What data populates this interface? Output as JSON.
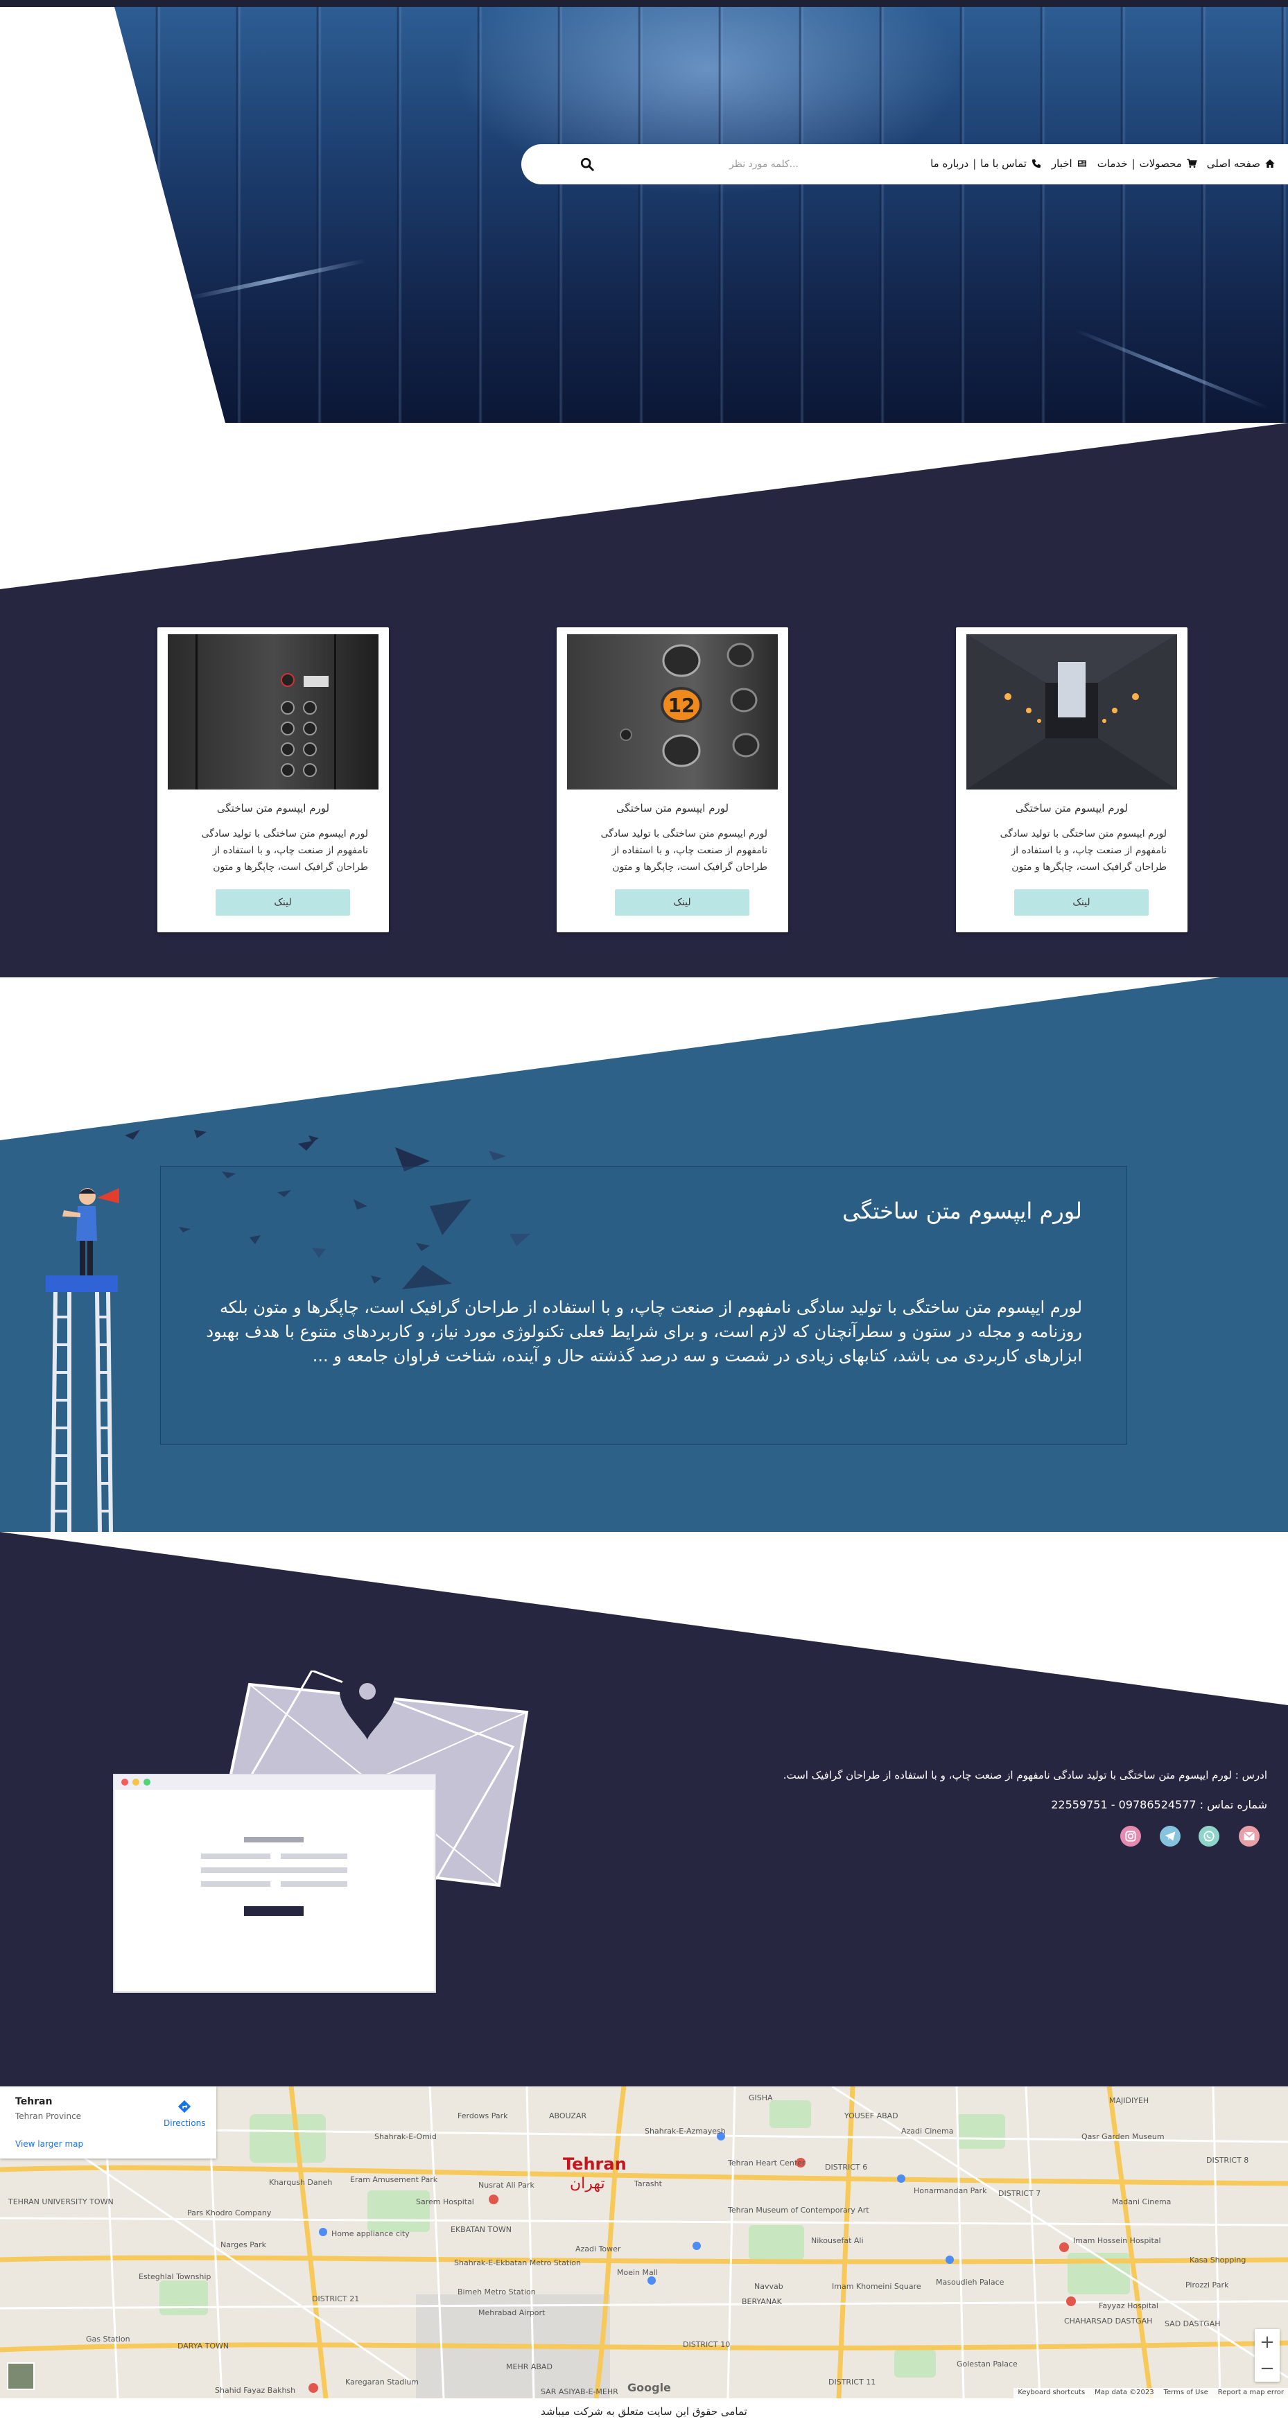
{
  "nav": {
    "home": "صفحه اصلی",
    "products": "محصولات",
    "services": "خدمات",
    "news": "اخبار",
    "contact": "تماس با ما",
    "about": "درباره ما",
    "search_placeholder": "کلمه مورد نظر..."
  },
  "cards": [
    {
      "title": "لورم ایپسوم متن ساختگی",
      "text": "لورم ایپسوم متن ساختگی با تولید سادگی نامفهوم از صنعت چاپ، و با استفاده از طراحان گرافیک است، چاپگرها و متون",
      "button": "لینک",
      "image": "elevator-buttons-photo"
    },
    {
      "title": "لورم ایپسوم متن ساختگی",
      "text": "لورم ایپسوم متن ساختگی با تولید سادگی نامفهوم از صنعت چاپ، و با استفاده از طراحان گرافیک است، چاپگرها و متون",
      "button": "لینک",
      "image": "elevator-floor-12-photo"
    },
    {
      "title": "لورم ایپسوم متن ساختگی",
      "text": "لورم ایپسوم متن ساختگی با تولید سادگی نامفهوم از صنعت چاپ، و با استفاده از طراحان گرافیک است، چاپگرها و متون",
      "button": "لینک",
      "image": "elevator-shaft-photo"
    }
  ],
  "about": {
    "title": "لورم ایپسوم متن ساختگی",
    "text": "لورم ایپسوم متن ساختگی با تولید سادگی نامفهوم از صنعت چاپ، و با استفاده از طراحان گرافیک است، چاپگرها و متون بلکه روزنامه و مجله در ستون و سطرآنچنان که لازم است، و برای شرایط فعلی تکنولوژی مورد نیاز، و کاربردهای متنوع با هدف بهبود ابزارهای کاربردی می باشد، کتابهای زیادی در شصت و سه درصد گذشته حال و آینده، شناخت فراوان جامعه و ..."
  },
  "contact": {
    "address": "ادرس : لورم ایپسوم متن ساختگی با تولید سادگی نامفهوم از صنعت چاپ، و با استفاده از طراحان گرافیک است.",
    "phone": "شماره تماس : 09786524577 - 22559751",
    "social": [
      {
        "name": "email-icon",
        "color": "#e8a0a8"
      },
      {
        "name": "whatsapp-icon",
        "color": "#8fd4c8"
      },
      {
        "name": "telegram-icon",
        "color": "#86c3dd"
      },
      {
        "name": "instagram-icon",
        "color": "#e78ab0"
      }
    ]
  },
  "map": {
    "place_title": "Tehran",
    "place_subtitle": "Tehran Province",
    "directions": "Directions",
    "view_larger": "View larger map",
    "city_name": "Tehran",
    "city_name_fa": "تهران",
    "zoom_in": "+",
    "zoom_out": "−",
    "attribution": [
      "Keyboard shortcuts",
      "Map data ©2023",
      "Terms of Use",
      "Report a map error"
    ],
    "logo": "Google",
    "labels": [
      "ABOUZAR",
      "GISHA",
      "YOUSEF ABAD",
      "MAJIDIYEH",
      "Ferdows Park",
      "Shahrak-E-Azmayesh",
      "Tehran Heart Center",
      "DISTRICT 6",
      "DISTRICT 7",
      "DISTRICT 8",
      "Azadi Cinema",
      "Qasr Garden Museum",
      "Eram Amusement Park",
      "Tehran Museum of Contemporary Art",
      "Honarmandan Park",
      "Madani Cinema",
      "TEHRAN UNIVERSITY TOWN",
      "Pars Khodro Company",
      "EKBATAN TOWN",
      "Nusrat Ali Park",
      "Azadi Tower",
      "Shahrak-E-Ekbatan Metro Station",
      "Nikousefat Ali",
      "Narges Park",
      "Home appliance city",
      "Imam Hossein Hospital",
      "Moein Mall",
      "Imam Khomeini Square",
      "Masoudieh Palace",
      "Esteghlal Township",
      "DISTRICT 21",
      "Bimeh Metro Station",
      "Mehrabad Airport",
      "DISTRICT 10",
      "DISTRICT 11",
      "Karegaran Stadium",
      "Gas Station",
      "DARYA TOWN",
      "Fayyaz Hospital",
      "Shahid Fayaz Bakhsh",
      "Golestan Palace",
      "Kasa Shopping",
      "Pirozzi Park",
      "CHAHARSAD DASTGAH",
      "SAD DASTGAH",
      "BERYANAK",
      "SAR ASIYAB-E-MEHR",
      "MEHR ABAD",
      "Navvab",
      "Sarem Hospital",
      "Tarasht",
      "Kharqush Daneh",
      "Shahrak-E-Omid"
    ]
  },
  "footer": {
    "text": "تمامی حقوق این سایت متعلق به شرکت      میباشد"
  }
}
